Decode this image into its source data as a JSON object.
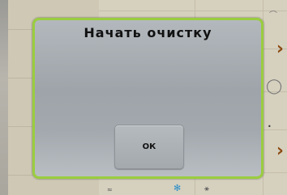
{
  "dialog": {
    "title": "Начать очистку",
    "ok_label": "ОК",
    "border_color": "#9acd3f"
  },
  "background": {
    "chevron_glyph": "›",
    "chevron_color": "#8a4a10"
  }
}
